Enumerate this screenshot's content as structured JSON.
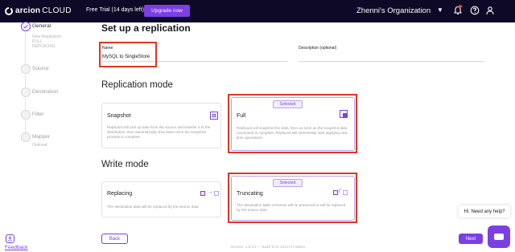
{
  "topbar": {
    "logo_name": "arcion",
    "logo_suffix": "CLOUD",
    "trial": "Free Trial (14 days left)",
    "upgrade": "Upgrade now",
    "org": "Zhenni's Organization"
  },
  "stepper": {
    "general": "General",
    "general_sub": [
      "New Replication",
      "FULL",
      "REPLACING"
    ],
    "source": "Source",
    "destination": "Destination",
    "filter": "Filter",
    "mapper": "Mapper",
    "mapper_sub": "Optional"
  },
  "page": {
    "title": "Set up a replication",
    "name_label": "Name",
    "name_value": "MySQL to SingleStore",
    "description_label": "Description (optional)",
    "description_value": ""
  },
  "replication_mode": {
    "heading": "Replication mode",
    "snapshot": {
      "title": "Snapshot",
      "desc": "Replicant will pick up data from the source and transfer it to the destination; then automatically shut down once the snapshot process is complete."
    },
    "full": {
      "badge": "Selected",
      "title": "Full",
      "desc": "Replicant will snapshot the data, then as soon as the snapshot data movement is complete, Replicant will seamlessly start applying real-time operations."
    }
  },
  "write_mode": {
    "heading": "Write mode",
    "replacing": {
      "title": "Replacing",
      "desc": "The destination data will be replaced by the source data"
    },
    "truncating": {
      "badge": "Selected",
      "title": "Truncating",
      "desc": "The destination table schemas will be preserved & will be replaced by the source data"
    }
  },
  "footer": {
    "back": "Back",
    "next": "Next",
    "version": "Version: 1.8.14 — Build 8.21.2022-07:58am",
    "feedback": "Feedback"
  },
  "chat": {
    "greeting": "Hi. Need any help?"
  },
  "colors": {
    "accent": "#7b3fe4",
    "topbar": "#0d0926",
    "highlight": "#e03526"
  }
}
